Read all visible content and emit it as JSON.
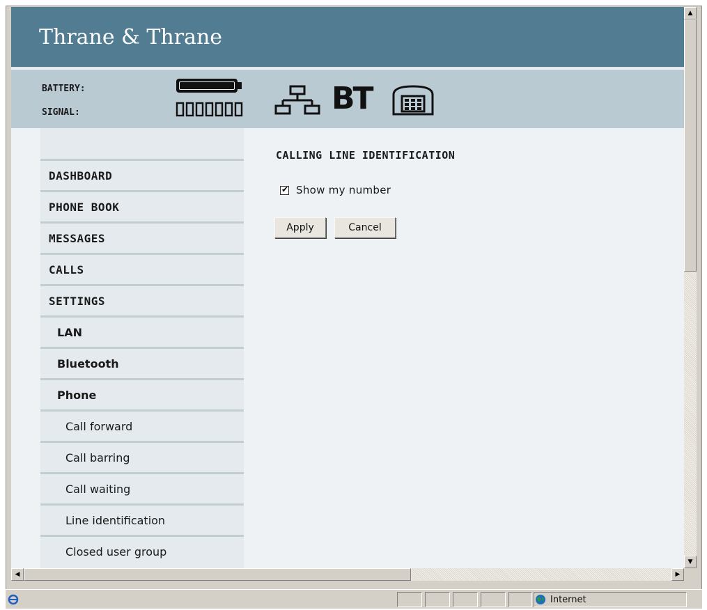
{
  "header": {
    "brand": "Thrane & Thrane",
    "battery_label": "BATTERY:",
    "signal_label": "SIGNAL:",
    "bt_label": "BT",
    "icons": [
      "battery-icon",
      "signal-bars-icon",
      "lan-network-icon",
      "bluetooth-bt-icon",
      "phone-icon"
    ],
    "colors": {
      "brand_bar": "#517c91",
      "status_bar": "#b9cad2"
    }
  },
  "sidebar": {
    "items": [
      {
        "label": "DASHBOARD",
        "level": 0
      },
      {
        "label": "PHONE BOOK",
        "level": 0
      },
      {
        "label": "MESSAGES",
        "level": 0
      },
      {
        "label": "CALLS",
        "level": 0
      },
      {
        "label": "SETTINGS",
        "level": 0
      },
      {
        "label": "LAN",
        "level": 1
      },
      {
        "label": "Bluetooth",
        "level": 1
      },
      {
        "label": "Phone",
        "level": 1
      },
      {
        "label": "Call forward",
        "level": 2
      },
      {
        "label": "Call barring",
        "level": 2
      },
      {
        "label": "Call waiting",
        "level": 2
      },
      {
        "label": "Line identification",
        "level": 2
      },
      {
        "label": "Closed user group",
        "level": 2
      }
    ]
  },
  "main": {
    "heading": "CALLING LINE IDENTIFICATION",
    "show_number_label": "Show my number",
    "show_number_checked": true,
    "apply_label": "Apply",
    "cancel_label": "Cancel"
  },
  "browser_status": {
    "zone": "Internet"
  }
}
